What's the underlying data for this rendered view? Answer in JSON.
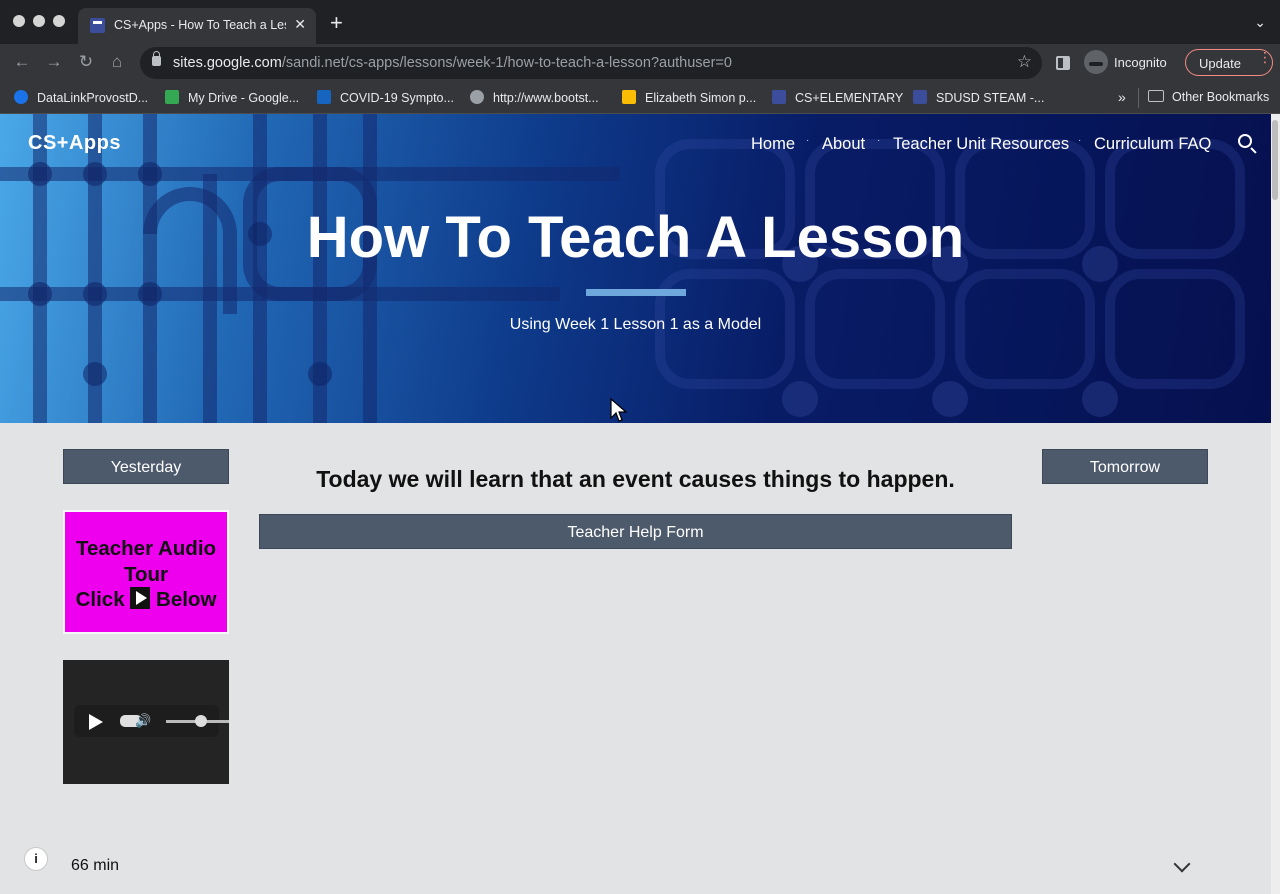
{
  "browser": {
    "tab_title": "CS+Apps - How To Teach a Lesson",
    "tab_close": "✕",
    "new_tab": "+",
    "url_host": "sites.google.com",
    "url_path": "/sandi.net/cs-apps/lessons/week-1/how-to-teach-a-lesson?authuser=0",
    "incognito_label": "Incognito",
    "update_label": "Update",
    "bookmarks": [
      {
        "label": "DataLinkProvostD...",
        "color": "#1a73e8"
      },
      {
        "label": "My Drive - Google...",
        "color": "#34a853"
      },
      {
        "label": "COVID-19 Sympto...",
        "color": "#1565c0"
      },
      {
        "label": "http://www.bootst...",
        "color": "#9aa0a6"
      },
      {
        "label": "Elizabeth Simon p...",
        "color": "#fbbc04"
      },
      {
        "label": "CS+ELEMENTARY",
        "color": "#3c4d9c"
      },
      {
        "label": "SDUSD STEAM -...",
        "color": "#3c4d9c"
      }
    ],
    "bookmarks_more": "»",
    "other_bookmarks": "Other Bookmarks"
  },
  "site": {
    "title": "CS+Apps",
    "nav": [
      "Home",
      "About",
      "Teacher Unit Resources",
      "Curriculum FAQ"
    ],
    "nav_separator": "·"
  },
  "hero": {
    "title": "How To Teach A Lesson",
    "subtitle": "Using Week 1 Lesson 1 as a Model"
  },
  "main": {
    "prev_button": "Yesterday",
    "next_button": "Tomorrow",
    "goal": "Today we will learn that an event causes things to happen.",
    "help_button": "Teacher Help Form",
    "audio_card": {
      "line1": "Teacher Audio",
      "line2": "Tour",
      "line3a": "Click",
      "line3b": "Below"
    }
  },
  "footer": {
    "info_icon": "i",
    "duration": "66 min"
  },
  "colors": {
    "button_bg": "#4d5a6b",
    "audio_card_bg": "#ee00ee",
    "accent_bar": "#6fa8dc"
  }
}
